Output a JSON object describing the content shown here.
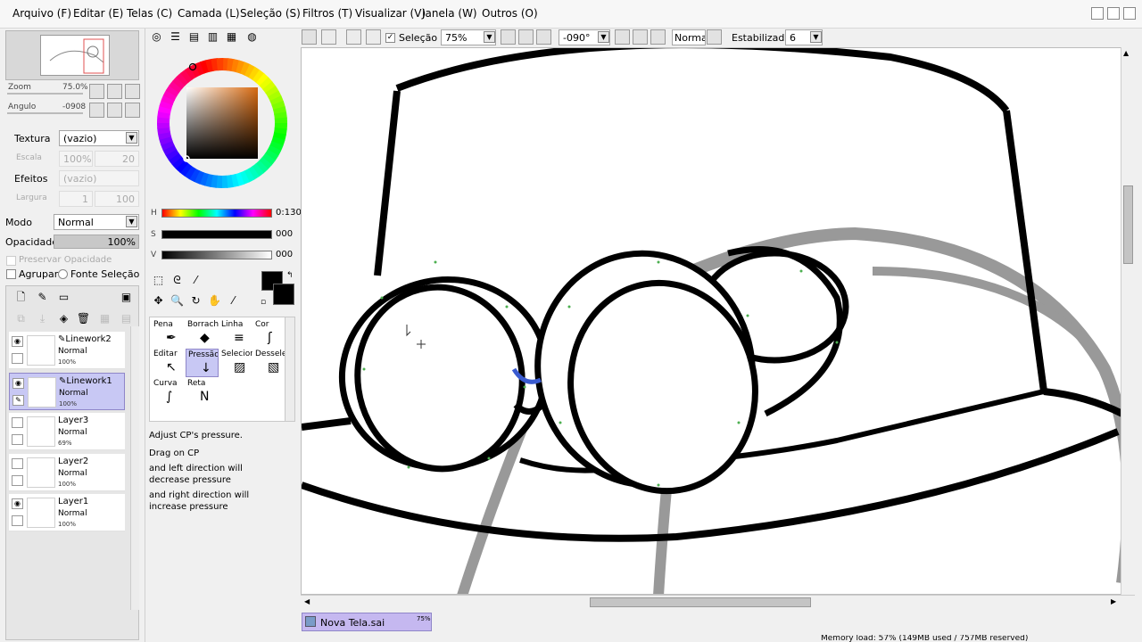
{
  "menu": [
    "Arquivo (F)",
    "Editar (E)",
    "Telas (C)",
    "Camada (L)",
    "Seleção (S)",
    "Filtros (T)",
    "Visualizar (V)",
    "Janela (W)",
    "Outros (O)"
  ],
  "toolbar": {
    "selection_label": "Seleção",
    "zoom_value": "75%",
    "angle_value": "-090°",
    "blend_value": "Normal",
    "stabilizer_label": "Estabilizador",
    "stabilizer_value": "6"
  },
  "navigator": {
    "zoom_label": "Zoom",
    "zoom_value": "75.0%",
    "angle_label": "Angulo",
    "angle_value": "-0908"
  },
  "texture": {
    "label": "Textura",
    "value": "(vazio)",
    "scale_label": "Escala",
    "scale_value": "100%",
    "scale_num": "20"
  },
  "effects": {
    "label": "Efeitos",
    "value": "(vazio)",
    "width_label": "Largura",
    "width_value": "1",
    "width_num": "100"
  },
  "layer_props": {
    "mode_label": "Modo",
    "mode_value": "Normal",
    "opacity_label": "Opacidade",
    "opacity_value": "100%",
    "preserve_label": "Preservar Opacidade",
    "clip_label": "Agrupar",
    "source_label": "Fonte Seleção"
  },
  "color": {
    "h_label": "H",
    "h_value": "0:130",
    "s_label": "S",
    "s_value": "000",
    "v_label": "V",
    "v_value": "000",
    "primary": "#000000",
    "secondary": "#000000",
    "hue_marker": 0.03,
    "sat_marker": 0.0,
    "val_marker": 0.0
  },
  "tools": [
    {
      "label": "Pena",
      "glyph": "✒"
    },
    {
      "label": "Borrach",
      "glyph": "◆"
    },
    {
      "label": "Linha",
      "glyph": "≡"
    },
    {
      "label": "Cor",
      "glyph": "ʃ"
    },
    {
      "label": "Editar",
      "glyph": "↖"
    },
    {
      "label": "Pressão",
      "glyph": "↓"
    },
    {
      "label": "Selecior",
      "glyph": "▨"
    },
    {
      "label": "Desselec",
      "glyph": "▧"
    },
    {
      "label": "Curva",
      "glyph": "∫"
    },
    {
      "label": "Reta",
      "glyph": "N"
    }
  ],
  "help": {
    "title": "Adjust CP's pressure.",
    "line1": "Drag on CP",
    "line2": "and left direction will decrease pressure",
    "line3": "and right direction will increase pressure"
  },
  "layers": [
    {
      "name": "Linework2",
      "mode": "Normal",
      "opacity": "100%",
      "visible": true,
      "linework": true,
      "selected": false
    },
    {
      "name": "Linework1",
      "mode": "Normal",
      "opacity": "100%",
      "visible": true,
      "linework": true,
      "selected": true
    },
    {
      "name": "Layer3",
      "mode": "Normal",
      "opacity": "69%",
      "visible": false,
      "linework": false,
      "selected": false
    },
    {
      "name": "Layer2",
      "mode": "Normal",
      "opacity": "100%",
      "visible": false,
      "linework": false,
      "selected": false
    },
    {
      "name": "Layer1",
      "mode": "Normal",
      "opacity": "100%",
      "visible": true,
      "linework": false,
      "selected": false
    }
  ],
  "canvas_tab": {
    "name": "Nova Tela.sai",
    "zoom": "75%"
  },
  "status": {
    "memory": "Memory load: 57% (149MB used / 757MB reserved)"
  },
  "colors": {
    "selected_layer": "#c8c8f4",
    "tab": "#c5b8f0",
    "accent_blue": "#3a5bd0"
  }
}
